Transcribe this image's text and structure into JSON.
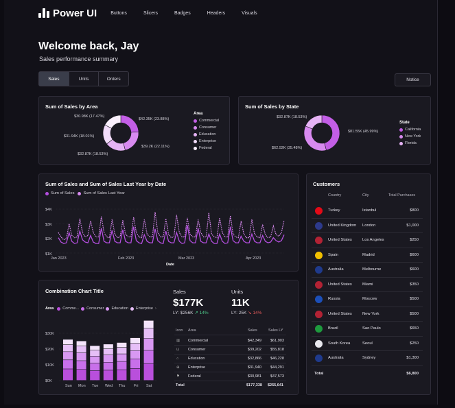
{
  "app": {
    "title": "Power UI"
  },
  "nav": {
    "items": [
      "Buttons",
      "Slicers",
      "Badges",
      "Headers",
      "Visuals"
    ]
  },
  "page": {
    "welcome": "Welcome back, Jay",
    "subtitle": "Sales performance summary"
  },
  "tabs": [
    {
      "label": "Sales",
      "active": true
    },
    {
      "label": "Units",
      "active": false
    },
    {
      "label": "Orders",
      "active": false
    }
  ],
  "notice_label": "Notice",
  "area_donut": {
    "title": "Sum of Sales by Area",
    "legend_title": "Area",
    "labels": [
      "$42.35K (23.88%)",
      "$39.2K (22.11%)",
      "$32.87K (18.53%)",
      "$31.94K (18.01%)",
      "$30.98K (17.47%)"
    ],
    "legend": [
      "Commercial",
      "Consumer",
      "Education",
      "Enterprise",
      "Federal"
    ],
    "colors": [
      "#c35ee6",
      "#d88af0",
      "#e6b3f5",
      "#f2dcfa",
      "#faf0fd"
    ],
    "percents": [
      23.88,
      22.11,
      18.53,
      18.01,
      17.47
    ]
  },
  "state_donut": {
    "title": "Sum of Sales by State",
    "legend_title": "State",
    "labels": [
      "$81.55K (45.99%)",
      "$62.92K (35.48%)",
      "$32.87K (18.53%)"
    ],
    "legend": [
      "California",
      "New York",
      "Florida"
    ],
    "colors": [
      "#c35ee6",
      "#d88af0",
      "#e6b3f5"
    ],
    "percents": [
      45.99,
      35.48,
      18.53
    ]
  },
  "line_chart": {
    "title": "Sum of Sales and Sum of Sales Last Year by Date",
    "legend": [
      "Sum of Sales",
      "Sum of Sales Last Year"
    ],
    "ylabels": [
      "$4K",
      "$3K",
      "$2K",
      "$1K"
    ],
    "xlabels": [
      "Jan 2023",
      "Feb 2023",
      "Mar 2023",
      "Apr 2023"
    ],
    "xlabel": "Date"
  },
  "chart_data": {
    "type": "line",
    "title": "Sum of Sales and Sum of Sales Last Year by Date",
    "xlabel": "Date",
    "ylim": [
      1000,
      4000
    ],
    "x_range": [
      "Jan 2023",
      "Apr 2023"
    ],
    "series": [
      {
        "name": "Sum of Sales",
        "values": [
          2050,
          1750,
          1650,
          1700,
          2400,
          1800,
          1650,
          1700,
          2500,
          1900,
          1750,
          1700,
          2200,
          1750,
          1650,
          1650,
          2700,
          1800,
          1700,
          1700,
          2550,
          1800,
          1700,
          1700,
          2600,
          1800,
          1700,
          1700,
          2800,
          1850,
          1700,
          1650,
          2250,
          1800,
          1700,
          1700,
          2650,
          1850,
          1700,
          1650,
          2500,
          1800,
          1700,
          1700,
          2400,
          1800,
          1650,
          1700,
          2900,
          1850,
          1700,
          1700,
          2700,
          1800,
          1700,
          1700,
          2300,
          1800,
          1650,
          1650,
          2300,
          1800,
          1650,
          1700,
          2800,
          1850,
          1700,
          1700,
          2150,
          1800,
          1700,
          1700,
          2300,
          1800,
          1700,
          1700,
          2200,
          1800,
          1700,
          1750,
          2050,
          1850,
          1750,
          1850,
          2250
        ]
      },
      {
        "name": "Sum of Sales Last Year",
        "values": [
          2400,
          2100,
          1900,
          2000,
          3000,
          2200,
          2050,
          2100,
          3350,
          2400,
          2100,
          2200,
          3200,
          2400,
          2100,
          2100,
          3500,
          2400,
          2100,
          2050,
          3300,
          2300,
          2050,
          2100,
          3250,
          2300,
          2100,
          2100,
          3450,
          2400,
          2100,
          2050,
          3300,
          2300,
          2100,
          2100,
          3800,
          2400,
          2100,
          2100,
          3350,
          2300,
          2050,
          2100,
          3600,
          2400,
          2100,
          2100,
          3400,
          2300,
          2100,
          2100,
          3300,
          2400,
          2100,
          2100,
          3750,
          2300,
          2100,
          2050,
          3400,
          2400,
          2100,
          2100,
          3550,
          2300,
          2100,
          2050,
          3200,
          2300,
          2050,
          2050,
          3300,
          2300,
          2100,
          2050,
          2950,
          2250,
          2050,
          2100,
          2850,
          2250,
          2150,
          2400,
          3250
        ]
      }
    ]
  },
  "combo": {
    "title": "Combination Chart Title",
    "legend_label": "Area",
    "legend": [
      "Comme...",
      "Consumer",
      "Education",
      "Enterprise"
    ],
    "ylabels": [
      "$30K",
      "$20K",
      "$10K",
      "$0K"
    ],
    "days": [
      "Sun",
      "Mon",
      "Tue",
      "Wed",
      "Thu",
      "Fri",
      "Sat"
    ],
    "totals": [
      26,
      25,
      22,
      23,
      24,
      27,
      38
    ],
    "colors": [
      "#b94fdc",
      "#c870ea",
      "#d898f2",
      "#e6bff7",
      "#f4e4fb"
    ]
  },
  "kpis": {
    "sales": {
      "label": "Sales",
      "value": "$177K",
      "ly": "LY: $256K",
      "change": "↗ 14%"
    },
    "units": {
      "label": "Units",
      "value": "11K",
      "ly": "LY: 25K",
      "change": "↘ 14%"
    }
  },
  "area_table": {
    "headers": [
      "Icon",
      "Area",
      "Sales",
      "Sales LY"
    ],
    "rows": [
      {
        "area": "Commercial",
        "sales": "$42,349",
        "ly": "$61,903"
      },
      {
        "area": "Consumer",
        "sales": "$39,202",
        "ly": "$55,818"
      },
      {
        "area": "Education",
        "sales": "$32,866",
        "ly": "$46,228"
      },
      {
        "area": "Enterprise",
        "sales": "$31,940",
        "ly": "$44,291"
      },
      {
        "area": "Federal",
        "sales": "$30,981",
        "ly": "$47,573"
      }
    ],
    "total": {
      "label": "Total",
      "sales": "$177,338",
      "ly": "$255,641"
    }
  },
  "customers": {
    "title": "Customers",
    "headers": [
      "Country",
      "City",
      "Total Purchases"
    ],
    "rows": [
      {
        "country": "Turkey",
        "city": "Istanbul",
        "amount": "$800",
        "flag": "#e30a17"
      },
      {
        "country": "United Kingdom",
        "city": "London",
        "amount": "$1,000",
        "flag": "#2d3a8c"
      },
      {
        "country": "United States",
        "city": "Los Angeles",
        "amount": "$250",
        "flag": "#b22234"
      },
      {
        "country": "Spain",
        "city": "Madrid",
        "amount": "$600",
        "flag": "#f1bf00"
      },
      {
        "country": "Australia",
        "city": "Melbourne",
        "amount": "$600",
        "flag": "#1f3a8c"
      },
      {
        "country": "United States",
        "city": "Miami",
        "amount": "$350",
        "flag": "#b22234"
      },
      {
        "country": "Russia",
        "city": "Moscow",
        "amount": "$500",
        "flag": "#1c4fb8"
      },
      {
        "country": "United States",
        "city": "New York",
        "amount": "$500",
        "flag": "#b22234"
      },
      {
        "country": "Brazil",
        "city": "Sao Paulo",
        "amount": "$650",
        "flag": "#1e9a3e"
      },
      {
        "country": "South Korea",
        "city": "Seoul",
        "amount": "$250",
        "flag": "#e8e8ee"
      },
      {
        "country": "Australia",
        "city": "Sydney",
        "amount": "$1,300",
        "flag": "#1f3a8c"
      }
    ],
    "total_label": "Total",
    "total": "$6,800"
  }
}
